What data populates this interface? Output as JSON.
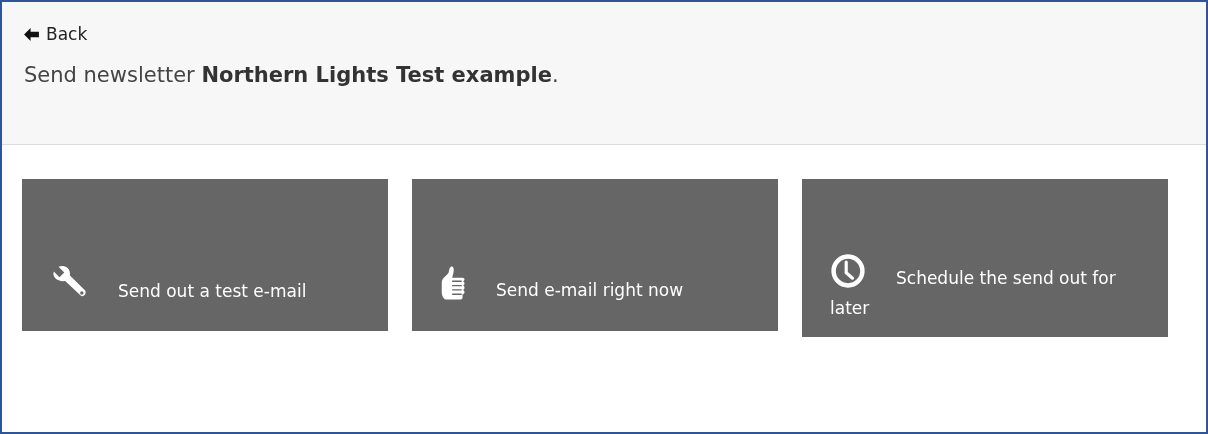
{
  "back_link": {
    "label": "Back"
  },
  "heading": "Send newsletter **Northern Lights Test example**.",
  "actions": [
    {
      "kind": "wrench",
      "label": "Send out a test e-mail"
    },
    {
      "kind": "thumb",
      "label": "Send e-mail right now"
    },
    {
      "kind": "clock",
      "label": "Schedule the send out for later"
    }
  ]
}
